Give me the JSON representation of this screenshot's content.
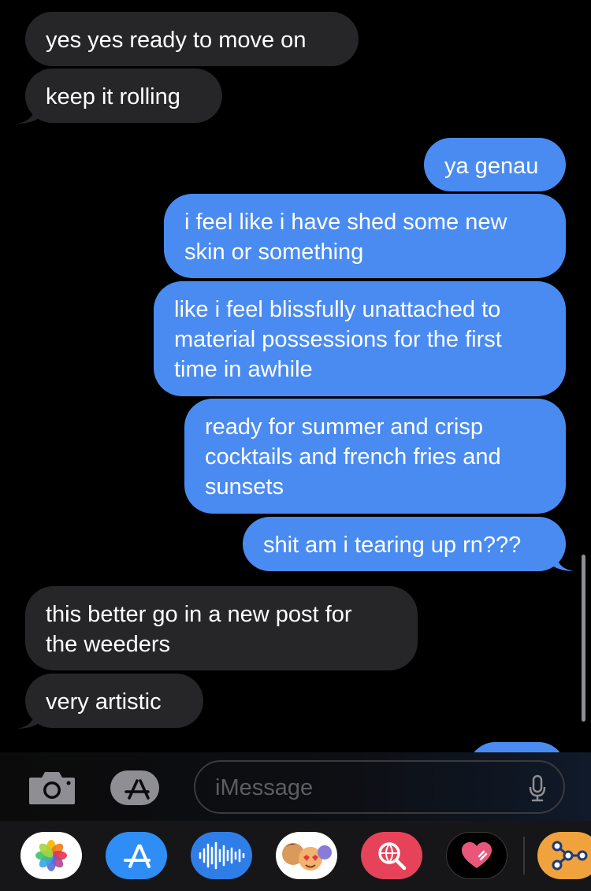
{
  "messages": [
    {
      "text": "yes yes ready to move on",
      "from": "them"
    },
    {
      "text": "keep it rolling",
      "from": "them"
    },
    {
      "text": "ya genau",
      "from": "me"
    },
    {
      "text": "i feel like i have shed some new\nskin or something",
      "from": "me"
    },
    {
      "text": "like i feel blissfully unattached to\nmaterial possessions for the first\ntime in awhile",
      "from": "me"
    },
    {
      "text": "ready for summer and crisp\ncocktails and french fries and\nsunsets",
      "from": "me"
    },
    {
      "text": "shit am i tearing up rn???",
      "from": "me"
    },
    {
      "text": "this better go in a new post for\nthe weeders",
      "from": "them"
    },
    {
      "text": "very artistic",
      "from": "them"
    }
  ],
  "compose": {
    "placeholder": "iMessage",
    "camera_icon": "camera-icon",
    "apps_icon": "app-store-icon",
    "mic_icon": "microphone-icon"
  },
  "app_tray": {
    "apps": [
      "photos-icon",
      "app-store-icon",
      "audio-message-icon",
      "memoji-icon",
      "web-image-search-icon",
      "digital-touch-icon",
      "shortcuts-icon"
    ]
  },
  "colors": {
    "background": "#000000",
    "incoming_bubble": "#262628",
    "outgoing_bubble": "#4a8bf2",
    "tray": "#161618"
  }
}
